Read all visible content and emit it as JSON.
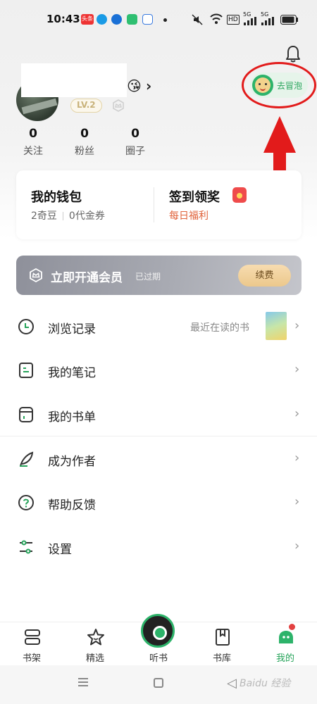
{
  "status_bar": {
    "time": "10:43",
    "toutiao_badge": "头条",
    "network_hd": "HD",
    "network_5g_a": "5G",
    "network_5g_b": "5G"
  },
  "profile": {
    "emoji": "😘",
    "level": "LV.2",
    "bubble_label": "去冒泡",
    "stats": [
      {
        "value": "0",
        "label": "关注"
      },
      {
        "value": "0",
        "label": "粉丝"
      },
      {
        "value": "0",
        "label": "圈子"
      }
    ]
  },
  "wallet": {
    "title": "我的钱包",
    "beans": "2奇豆",
    "coupons": "0代金券",
    "sign_title": "签到领奖",
    "sign_sub": "每日福利"
  },
  "vip": {
    "title": "立即开通会员",
    "status": "已过期",
    "renew": "续费"
  },
  "menu": {
    "items": [
      {
        "label": "浏览记录",
        "icon": "clock-icon",
        "extra": "最近在读的书"
      },
      {
        "label": "我的笔记",
        "icon": "note-icon"
      },
      {
        "label": "我的书单",
        "icon": "booklist-icon"
      },
      {
        "label": "成为作者",
        "icon": "feather-icon"
      },
      {
        "label": "帮助反馈",
        "icon": "help-icon"
      },
      {
        "label": "设置",
        "icon": "settings-icon"
      }
    ]
  },
  "bottom_nav": {
    "items": [
      {
        "label": "书架",
        "icon": "bookshelf-icon"
      },
      {
        "label": "精选",
        "icon": "star-icon"
      },
      {
        "label": "听书",
        "icon": "disc-icon"
      },
      {
        "label": "书库",
        "icon": "bookmark-icon"
      },
      {
        "label": "我的",
        "icon": "robot-icon"
      }
    ]
  },
  "watermark": "Baidu 经验",
  "colors": {
    "accent": "#26a35a",
    "annotation": "#e21b1b",
    "sign_sub": "#e0623a"
  }
}
